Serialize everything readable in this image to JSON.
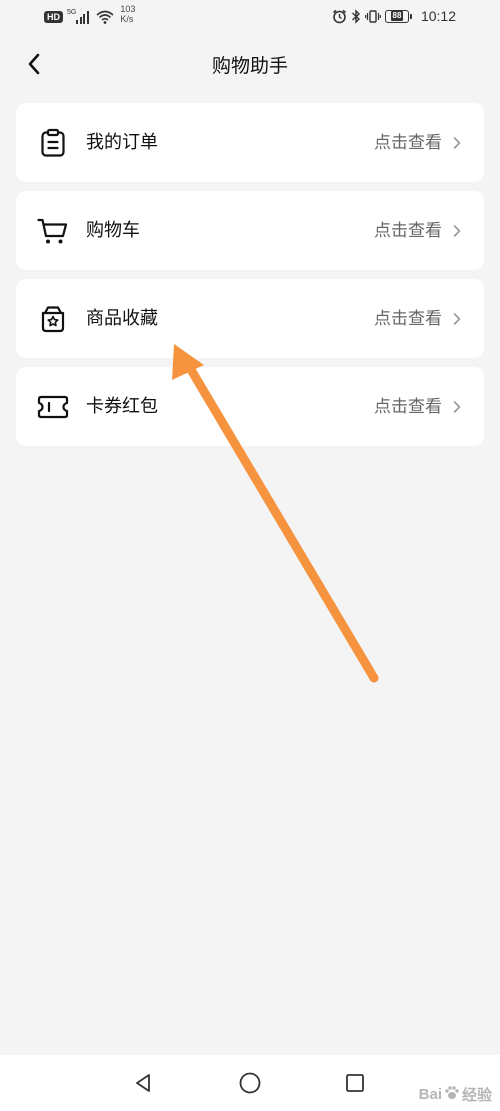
{
  "status_bar": {
    "hd_badge": "HD",
    "network_type": "5G",
    "net_speed_value": "103",
    "net_speed_unit": "K/s",
    "battery_level": "88",
    "time": "10:12"
  },
  "header": {
    "title": "购物助手",
    "back_icon": "chevron-left-icon"
  },
  "menu": {
    "action_label": "点击查看",
    "items": [
      {
        "label": "我的订单",
        "icon": "clipboard-list-icon"
      },
      {
        "label": "购物车",
        "icon": "shopping-cart-icon"
      },
      {
        "label": "商品收藏",
        "icon": "star-bag-icon"
      },
      {
        "label": "卡券红包",
        "icon": "ticket-icon"
      }
    ]
  },
  "nav_bar": {
    "back_icon": "triangle-back-icon",
    "home_icon": "circle-home-icon",
    "recent_icon": "square-recent-icon"
  },
  "watermark": {
    "brand_left": "Bai",
    "brand_right": "经验"
  },
  "colors": {
    "background": "#f4f4f4",
    "card": "#ffffff",
    "annotation_arrow": "#f5933f",
    "secondary_text": "#666666"
  }
}
